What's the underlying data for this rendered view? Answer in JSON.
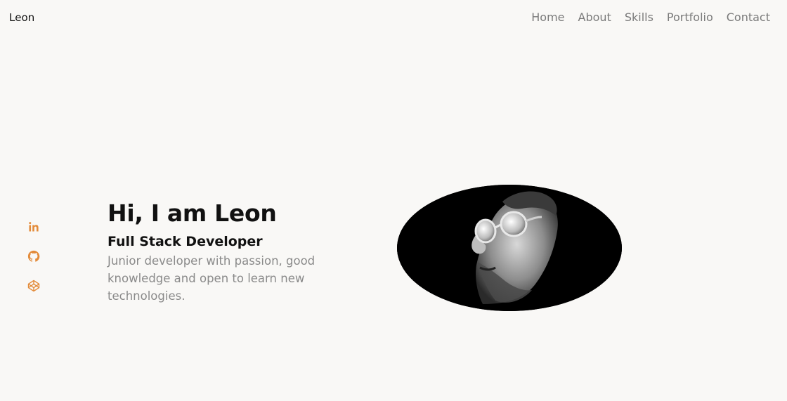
{
  "header": {
    "logo": "Leon",
    "nav": [
      "Home",
      "About",
      "Skills",
      "Portfolio",
      "Contact"
    ]
  },
  "social": [
    {
      "icon": "linkedin-icon"
    },
    {
      "icon": "github-icon"
    },
    {
      "icon": "codepen-icon"
    }
  ],
  "hero": {
    "title": "Hi, I am Leon",
    "subtitle": "Full Stack Developer",
    "description": "Junior developer with passion, good knowledge and open to learn new technologies."
  },
  "colors": {
    "background": "#f9f8f6",
    "accent": "#e38b3a",
    "text": "#111111",
    "muted": "#8a8a8a"
  }
}
